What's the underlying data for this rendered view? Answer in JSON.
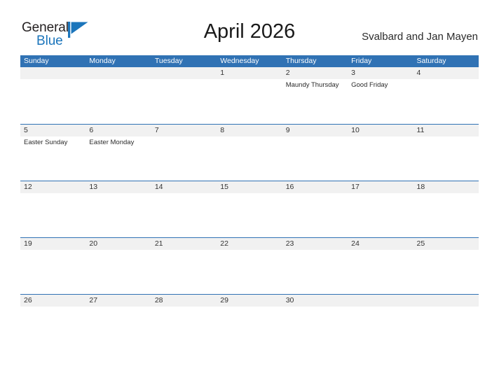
{
  "brand": {
    "name_part1": "General",
    "name_part2": "Blue",
    "flag_icon": "triangle-flag-icon",
    "accent_color": "#1b75bb"
  },
  "header": {
    "month_title": "April 2026",
    "region": "Svalbard and Jan Mayen"
  },
  "calendar": {
    "header_color": "#3072b4",
    "band_color": "#f1f1f1",
    "weekdays": [
      "Sunday",
      "Monday",
      "Tuesday",
      "Wednesday",
      "Thursday",
      "Friday",
      "Saturday"
    ],
    "weeks": [
      [
        {
          "date": "",
          "events": []
        },
        {
          "date": "",
          "events": []
        },
        {
          "date": "",
          "events": []
        },
        {
          "date": "1",
          "events": []
        },
        {
          "date": "2",
          "events": [
            "Maundy Thursday"
          ]
        },
        {
          "date": "3",
          "events": [
            "Good Friday"
          ]
        },
        {
          "date": "4",
          "events": []
        }
      ],
      [
        {
          "date": "5",
          "events": [
            "Easter Sunday"
          ]
        },
        {
          "date": "6",
          "events": [
            "Easter Monday"
          ]
        },
        {
          "date": "7",
          "events": []
        },
        {
          "date": "8",
          "events": []
        },
        {
          "date": "9",
          "events": []
        },
        {
          "date": "10",
          "events": []
        },
        {
          "date": "11",
          "events": []
        }
      ],
      [
        {
          "date": "12",
          "events": []
        },
        {
          "date": "13",
          "events": []
        },
        {
          "date": "14",
          "events": []
        },
        {
          "date": "15",
          "events": []
        },
        {
          "date": "16",
          "events": []
        },
        {
          "date": "17",
          "events": []
        },
        {
          "date": "18",
          "events": []
        }
      ],
      [
        {
          "date": "19",
          "events": []
        },
        {
          "date": "20",
          "events": []
        },
        {
          "date": "21",
          "events": []
        },
        {
          "date": "22",
          "events": []
        },
        {
          "date": "23",
          "events": []
        },
        {
          "date": "24",
          "events": []
        },
        {
          "date": "25",
          "events": []
        }
      ],
      [
        {
          "date": "26",
          "events": []
        },
        {
          "date": "27",
          "events": []
        },
        {
          "date": "28",
          "events": []
        },
        {
          "date": "29",
          "events": []
        },
        {
          "date": "30",
          "events": []
        },
        {
          "date": "",
          "events": []
        },
        {
          "date": "",
          "events": []
        }
      ]
    ]
  }
}
